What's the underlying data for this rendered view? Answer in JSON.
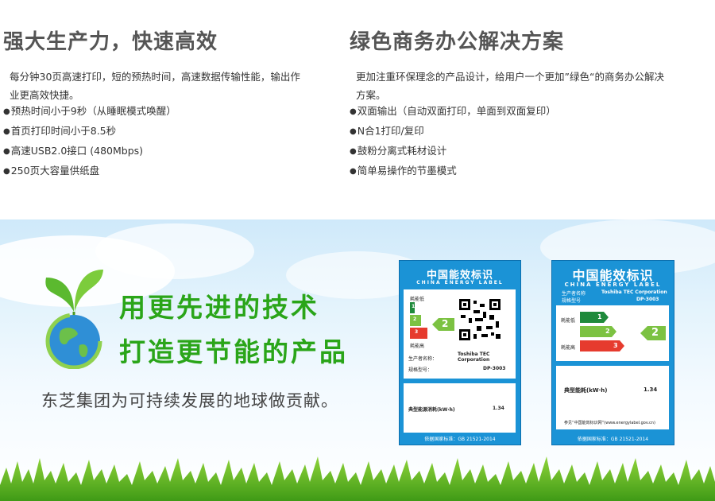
{
  "left": {
    "title": "强大生产力，快速高效",
    "desc": "每分钟30页高速打印，短的预热时间，高速数据传输性能，输出作业更高效快捷。",
    "bullets": [
      "预热时间小于9秒（从睡眠模式唤醒）",
      "首页打印时间小于8.5秒",
      "高速USB2.0接口 (480Mbps)",
      "250页大容量供纸盘"
    ]
  },
  "right": {
    "title": "绿色商务办公解决方案",
    "desc": "更加注重环保理念的产品设计，给用户一个更加”绿色“的商务办公解决方案。",
    "bullets": [
      "双面输出（自动双面打印，单面到双面复印）",
      "N合1打印/复印",
      "鼓粉分离式耗材设计",
      "简单易操作的节墨模式"
    ]
  },
  "banner": {
    "slogan1": "用更先进的技术",
    "slogan2": "打造更节能的产品",
    "subtitle": "东芝集团为可持续发展的地球做贡献。"
  },
  "label_small": {
    "title_cn": "中国能效标识",
    "title_en": "CHINA ENERGY LABEL",
    "low": "耗能低",
    "high": "耗能高",
    "grade": "2",
    "grades": [
      "1",
      "2",
      "3"
    ],
    "maker_label": "生产者名称：",
    "maker": "Toshiba TEC Corporation",
    "model_label": "规格型号：",
    "model": "DP-3003",
    "energy_label": "典型能源消耗(kW·h)",
    "energy": "1.34",
    "standard": "依据国家标准：GB 21521-2014"
  },
  "label_large": {
    "title_cn": "中国能效标识",
    "title_en": "CHINA ENERGY LABEL",
    "maker_label": "生产者名称",
    "maker": "Toshiba TEC Corporation",
    "model_label": "规格型号",
    "model": "DP-3003",
    "low": "耗能低",
    "high": "耗能高",
    "grade": "2",
    "grades": [
      "1",
      "2",
      "3"
    ],
    "energy_label": "典型能耗(kW·h)",
    "energy": "1.34",
    "note": "参见“中国能效标识网”(www.energylabel.gov.cn)",
    "standard": "依据国家标准：GB 21521-2014"
  },
  "colors": {
    "heading": "#555555",
    "slogan": "#2aa519",
    "label_blue": "#1b93d6",
    "grade1": "#1f8a3b",
    "grade2": "#7cc242",
    "grade3": "#e63b2e"
  }
}
